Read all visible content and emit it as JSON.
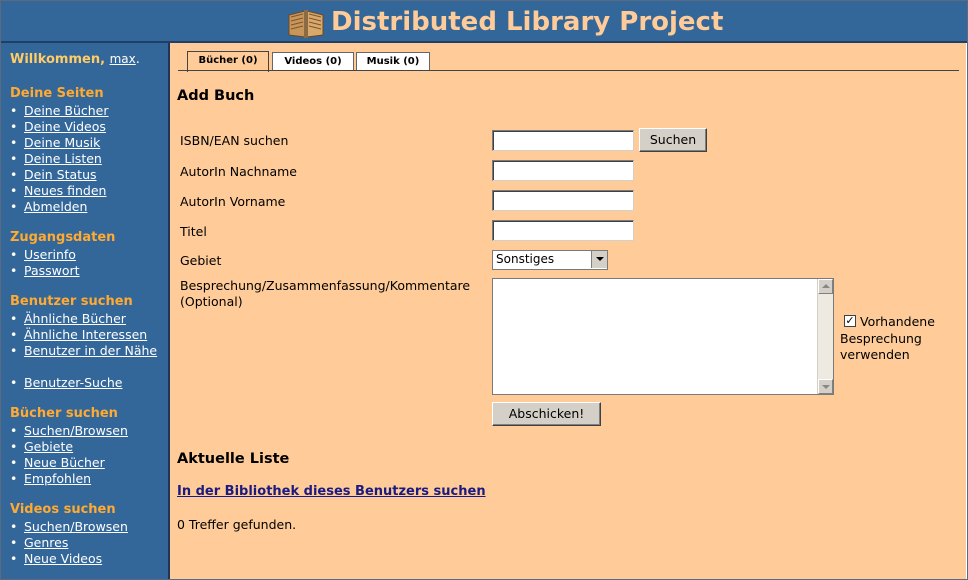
{
  "header": {
    "title": "Distributed Library Project",
    "icon": "open-book-icon"
  },
  "sidebar": {
    "welcome_text": "Willkommen,",
    "username": "max",
    "welcome_suffix": ".",
    "sections": [
      {
        "title": "Deine Seiten",
        "items": [
          "Deine Bücher",
          "Deine Videos",
          "Deine Musik",
          "Deine Listen",
          "Dein Status",
          "Neues finden",
          "Abmelden"
        ]
      },
      {
        "title": "Zugangsdaten",
        "items": [
          "Userinfo",
          "Passwort"
        ]
      },
      {
        "title": "Benutzer suchen",
        "items": [
          "Ähnliche Bücher",
          "Ähnliche Interessen",
          "Benutzer in der Nähe"
        ],
        "extra": "Benutzer-Suche"
      },
      {
        "title": "Bücher suchen",
        "items": [
          "Suchen/Browsen",
          "Gebiete",
          "Neue Bücher",
          "Empfohlen"
        ]
      },
      {
        "title": "Videos suchen",
        "items": [
          "Suchen/Browsen",
          "Genres",
          "Neue Videos"
        ]
      }
    ]
  },
  "tabs": [
    {
      "label": "Bücher (0)",
      "active": true
    },
    {
      "label": "Videos (0)",
      "active": false
    },
    {
      "label": "Musik (0)",
      "active": false
    }
  ],
  "form": {
    "heading": "Add Buch",
    "isbn_label": "ISBN/EAN suchen",
    "isbn_value": "",
    "search_button": "Suchen",
    "author_last_label": "AutorIn Nachname",
    "author_first_label": "AutorIn Vorname",
    "title_label": "Titel",
    "gebiet_label": "Gebiet",
    "gebiet_value": "Sonstiges",
    "review_label": "Besprechung/Zusammenfassung/Kommentare",
    "review_optional": "(Optional)",
    "checkbox_checked": true,
    "checkbox_label_1": "Vorhandene",
    "checkbox_label_2": "Besprechung",
    "checkbox_label_3": "verwenden",
    "submit_button": "Abschicken!"
  },
  "list": {
    "heading": "Aktuelle Liste",
    "search_link": "In der Bibliothek dieses Benutzers suchen",
    "result_text": "0 Treffer gefunden."
  },
  "colors": {
    "header_bg": "#336699",
    "title": "#ffcc99",
    "main_bg": "#ffcc99",
    "section_heading": "#ffaa33"
  }
}
